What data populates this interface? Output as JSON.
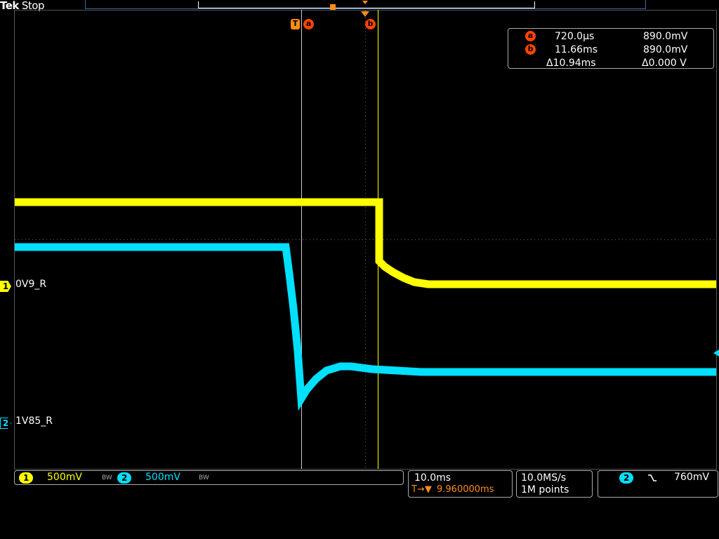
{
  "header": {
    "brand": "Tek",
    "status": "Stop"
  },
  "trigger_marker": "T",
  "cursor_readout": {
    "a_label": "a",
    "a_time": "720.0µs",
    "a_volt": "890.0mV",
    "b_label": "b",
    "b_time": "11.66ms",
    "b_volt": "890.0mV",
    "delta_time": "Δ10.94ms",
    "delta_volt": "Δ0.000 V"
  },
  "channels": [
    {
      "number": "1",
      "label": "0V9_R",
      "scale": "500mV",
      "bw": "BW",
      "color": "#ffff00"
    },
    {
      "number": "2",
      "label": "1V85_R",
      "scale": "500mV",
      "bw": "BW",
      "color": "#00e0ff"
    }
  ],
  "horizontal": {
    "scale": "10.0ms",
    "position": "9.960000ms",
    "position_prefix": "T→▼"
  },
  "acquisition": {
    "rate": "10.0MS/s",
    "length": "1M points"
  },
  "trigger": {
    "source": "2",
    "slope_icon": "falling-edge-icon",
    "level": "760mV"
  }
}
